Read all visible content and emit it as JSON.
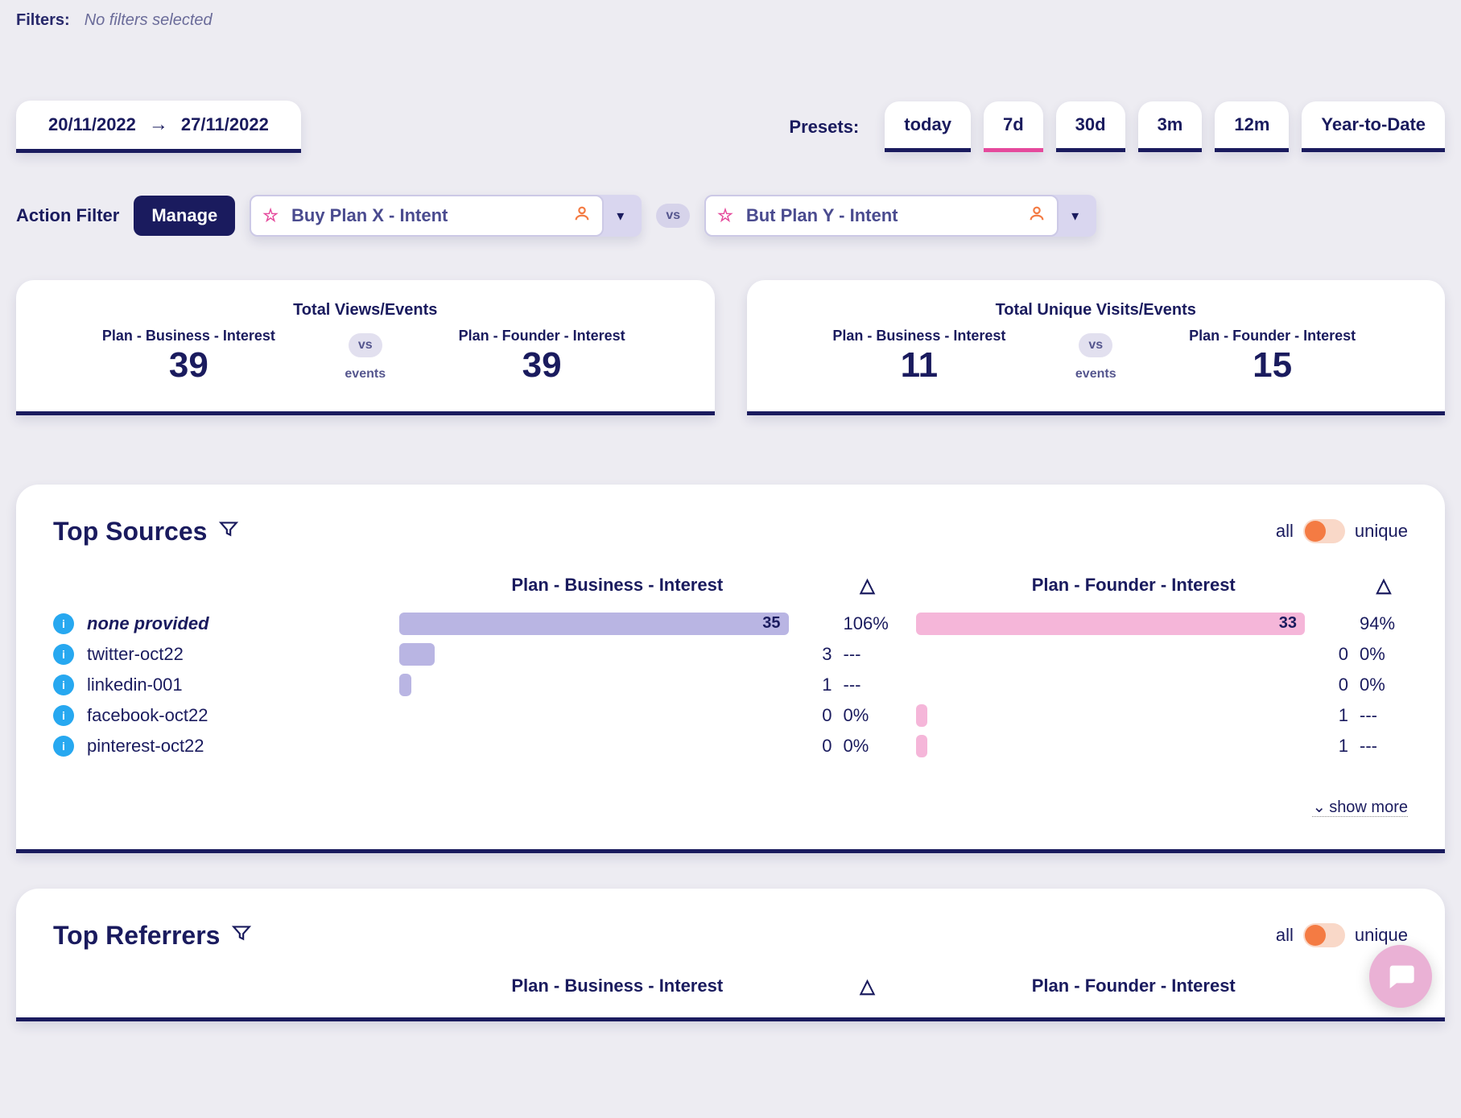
{
  "filters": {
    "label": "Filters:",
    "value": "No filters selected"
  },
  "daterange": {
    "from": "20/11/2022",
    "to": "27/11/2022"
  },
  "presets": {
    "label": "Presets:",
    "items": [
      "today",
      "7d",
      "30d",
      "3m",
      "12m",
      "Year-to-Date"
    ],
    "active_index": 1
  },
  "action_filter": {
    "label": "Action Filter",
    "manage_label": "Manage",
    "option_a": "Buy Plan X - Intent",
    "vs": "vs",
    "option_b": "But Plan Y - Intent"
  },
  "stats": {
    "card_a": {
      "title": "Total Views/Events",
      "left_label": "Plan - Business - Interest",
      "left_value": "39",
      "right_label": "Plan - Founder - Interest",
      "right_value": "39",
      "vs": "vs",
      "sublabel": "events"
    },
    "card_b": {
      "title": "Total Unique Visits/Events",
      "left_label": "Plan - Business - Interest",
      "left_value": "11",
      "right_label": "Plan - Founder - Interest",
      "right_value": "15",
      "vs": "vs",
      "sublabel": "events"
    }
  },
  "top_sources": {
    "title": "Top Sources",
    "toggle_left": "all",
    "toggle_right": "unique",
    "header_a": "Plan - Business - Interest",
    "header_b": "Plan - Founder - Interest",
    "rows": [
      {
        "label": "none provided",
        "italic": true,
        "a_val": 35,
        "a_pct": 100,
        "a_delta": "106%",
        "b_val": 33,
        "b_pct": 100,
        "b_delta": "94%"
      },
      {
        "label": "twitter-oct22",
        "italic": false,
        "a_val": 3,
        "a_pct": 9,
        "a_delta": "---",
        "b_val": 0,
        "b_pct": 0,
        "b_delta": "0%"
      },
      {
        "label": "linkedin-001",
        "italic": false,
        "a_val": 1,
        "a_pct": 3,
        "a_delta": "---",
        "b_val": 0,
        "b_pct": 0,
        "b_delta": "0%"
      },
      {
        "label": "facebook-oct22",
        "italic": false,
        "a_val": 0,
        "a_pct": 0,
        "a_delta": "0%",
        "b_val": 1,
        "b_pct": 3,
        "b_delta": "---"
      },
      {
        "label": "pinterest-oct22",
        "italic": false,
        "a_val": 0,
        "a_pct": 0,
        "a_delta": "0%",
        "b_val": 1,
        "b_pct": 3,
        "b_delta": "---"
      }
    ],
    "show_more": "show more"
  },
  "top_referrers": {
    "title": "Top Referrers",
    "toggle_left": "all",
    "toggle_right": "unique",
    "header_a": "Plan - Business - Interest",
    "header_b": "Plan - Founder - Interest"
  },
  "chart_data": [
    {
      "type": "bar",
      "title": "Top Sources — Plan - Business - Interest",
      "categories": [
        "none provided",
        "twitter-oct22",
        "linkedin-001",
        "facebook-oct22",
        "pinterest-oct22"
      ],
      "values": [
        35,
        3,
        1,
        0,
        0
      ],
      "delta": [
        "106%",
        "---",
        "---",
        "0%",
        "0%"
      ]
    },
    {
      "type": "bar",
      "title": "Top Sources — Plan - Founder - Interest",
      "categories": [
        "none provided",
        "twitter-oct22",
        "linkedin-001",
        "facebook-oct22",
        "pinterest-oct22"
      ],
      "values": [
        33,
        0,
        0,
        1,
        1
      ],
      "delta": [
        "94%",
        "0%",
        "0%",
        "---",
        "---"
      ]
    }
  ]
}
